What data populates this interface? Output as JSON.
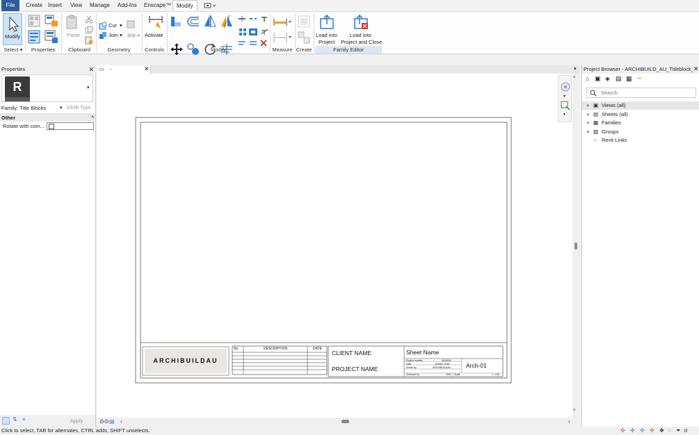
{
  "menu": {
    "tabs": [
      "File",
      "Create",
      "Insert",
      "View",
      "Manage",
      "Add-Ins",
      "Enscape™",
      "Modify"
    ],
    "active": "Modify"
  },
  "ribbon": {
    "select": {
      "modify_label": "Modify",
      "panel_label": "Select"
    },
    "properties": {
      "panel_label": "Properties"
    },
    "clipboard": {
      "paste_label": "Paste",
      "panel_label": "Clipboard"
    },
    "geometry": {
      "cut_label": "Cut",
      "join_label": "Join",
      "panel_label": "Geometry"
    },
    "controls": {
      "activate_label": "Activate",
      "panel_label": "Controls"
    },
    "modify": {
      "panel_label": "Modify"
    },
    "measure": {
      "panel_label": "Measure"
    },
    "create": {
      "panel_label": "Create"
    },
    "family_editor": {
      "load_project_line1": "Load into",
      "load_project_line2": "Project",
      "load_close_line1": "Load into",
      "load_close_line2": "Project and Close",
      "panel_label": "Family Editor"
    }
  },
  "properties": {
    "title": "Properties",
    "type_badge": "R",
    "family_label": "Family: Title Blocks",
    "edit_type_label": "Edit Type",
    "group_other": "Other",
    "param_rotate_label": "Rotate with com...",
    "apply_label": "Apply"
  },
  "view": {
    "tab_label": "-"
  },
  "titleblock": {
    "logo_text": "ARCHIBUILDAU",
    "rev_headers": [
      "No.",
      "DESCRIPTION",
      "DATE"
    ],
    "client_name": "CLIENT NAME",
    "project_name": "PROJECT NAME",
    "sheet_name": "Sheet Name",
    "sheet_number": "Arch-01",
    "info_rows": [
      {
        "label": "Project number",
        "value": "0000000"
      },
      {
        "label": "Date",
        "value": "16 MAY, 2020"
      },
      {
        "label": "Drawn by",
        "value": "ARCHIBUILDAU"
      },
      {
        "label": "Checked by",
        "value": "CHK"
      }
    ],
    "scale_label": "Scale",
    "scale_value": "1 : 100"
  },
  "browser": {
    "title": "Project Browser - ARCHIBUILD_AU_Titleblock_...",
    "search_placeholder": "Search",
    "items": [
      {
        "label": "Views (all)"
      },
      {
        "label": "Sheets (all)"
      },
      {
        "label": "Families"
      },
      {
        "label": "Groups"
      },
      {
        "label": "Revit Links"
      }
    ]
  },
  "status": {
    "hint": "Click to select, TAB for alternates, CTRL adds, SHIFT unselects.",
    "filter_count": ":0"
  },
  "colors": {
    "file_tab": "#2f5d9c",
    "accent_blue": "#2c7bd1",
    "accent_orange": "#f59a1b",
    "delete_red": "#d23a3a"
  }
}
